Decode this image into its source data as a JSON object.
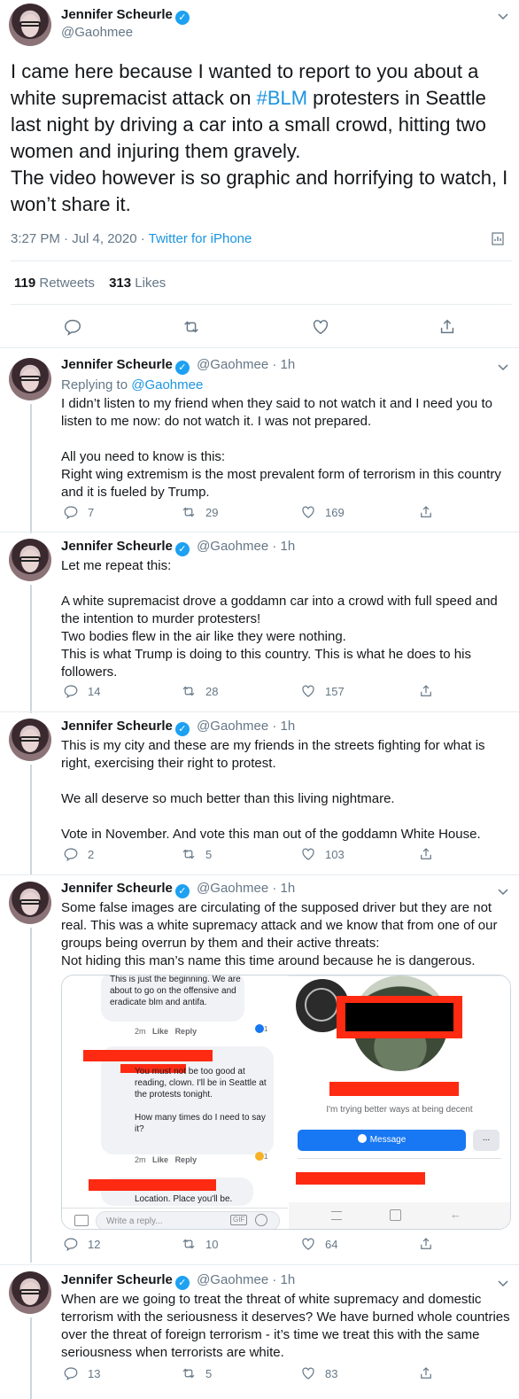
{
  "main_tweet": {
    "author_name": "Jennifer Scheurle",
    "author_handle": "@Gaohmee",
    "text_before": "I came here because I wanted to report to you about a white supremacist attack on ",
    "hashtag": "#BLM",
    "text_after": " protesters in Seattle last night by driving a car into a small crowd, hitting two women and injuring them gravely.\nThe video however is so graphic and horrifying to watch, I won’t share it.",
    "timestamp": "3:27 PM · Jul 4, 2020 · ",
    "source": "Twitter for iPhone",
    "retweets_count": "119",
    "retweets_label": "Retweets",
    "likes_count": "313",
    "likes_label": "Likes"
  },
  "replies": [
    {
      "author_name": "Jennifer Scheurle",
      "author_handle": "@Gaohmee",
      "age": "· 1h",
      "replying_prefix": "Replying to ",
      "replying_to": "@Gaohmee",
      "text": "I didn’t listen to my friend when they said to not watch it and I need you to listen to me now: do not watch it. I was not prepared.\n\nAll you need to know is this:\nRight wing extremism is the most prevalent form of terrorism in this country and it is fueled by Trump.",
      "replies": "7",
      "retweets": "29",
      "likes": "169"
    },
    {
      "author_name": "Jennifer Scheurle",
      "author_handle": "@Gaohmee",
      "age": "· 1h",
      "text": "Let me repeat this:\n\nA white supremacist drove a goddamn car into a crowd with full speed and the intention to murder protesters!\nTwo bodies flew in the air like they were nothing.\nThis is what Trump is doing to this country. This is what he does to his followers.",
      "replies": "14",
      "retweets": "28",
      "likes": "157"
    },
    {
      "author_name": "Jennifer Scheurle",
      "author_handle": "@Gaohmee",
      "age": "· 1h",
      "text": "This is my city and these are my friends in the streets fighting for what is right, exercising their right to protest.\n\nWe all deserve so much better than this living nightmare.\n\nVote in November. And vote this man out of the goddamn White House.",
      "replies": "2",
      "retweets": "5",
      "likes": "103"
    },
    {
      "author_name": "Jennifer Scheurle",
      "author_handle": "@Gaohmee",
      "age": "· 1h",
      "text": "Some false images are circulating of the supposed driver but they are not real. This was a white supremacy attack and we know that from one of our groups being overrun by them and their active threats:\nNot hiding this man’s name this time around because he is dangerous.",
      "replies": "12",
      "retweets": "10",
      "likes": "64"
    },
    {
      "author_name": "Jennifer Scheurle",
      "author_handle": "@Gaohmee",
      "age": "· 1h",
      "text": "When are we going to treat the threat of white supremacy and domestic terrorism with the seriousness it deserves? We have burned whole countries over the threat of foreign terrorism - it’s time we treat this with the same seriousness when terrorists are white.",
      "replies": "13",
      "retweets": "5",
      "likes": "83"
    }
  ],
  "embedded_screenshot": {
    "comment1": "This is just the beginning. We are about to go on the offensive and eradicate blm and antifa.",
    "comment1_time": "2m",
    "comment1_like": "Like",
    "comment1_reply": "Reply",
    "comment1_reaction_count": "1",
    "comment2": "You must not be too good at reading, clown. I'll be in Seattle at the protests tonight.\n\nHow many times do I need to say it?",
    "comment2_time": "2m",
    "comment2_like": "Like",
    "comment2_reply": "Reply",
    "comment2_reaction_count": "1",
    "comment3": "Location. Place you'll be.",
    "reply_placeholder": "Write a reply...",
    "gif_label": "GIF",
    "profile_bio": "I'm trying better ways at being decent",
    "message_button": "Message",
    "more_button": "..."
  },
  "colors": {
    "accent": "#1da1f2",
    "link": "#1b95e0",
    "text": "#14171a",
    "muted": "#657786",
    "divider": "#e6ecf0",
    "redaction": "#ff2a12"
  }
}
